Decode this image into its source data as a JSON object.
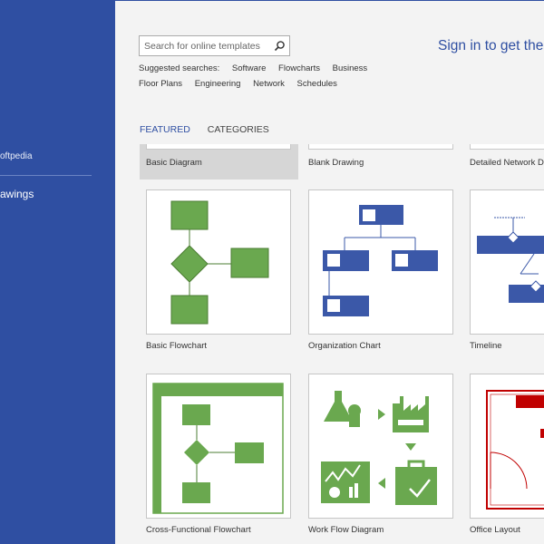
{
  "sidebar": {
    "user": "oftpedia",
    "item": "awings"
  },
  "search": {
    "placeholder": "Search for online templates"
  },
  "suggested": {
    "label": "Suggested searches:",
    "items": [
      "Software",
      "Flowcharts",
      "Business",
      "Floor Plans",
      "Engineering",
      "Network",
      "Schedules"
    ]
  },
  "signin": "Sign in to get the",
  "tabs": [
    {
      "label": "FEATURED",
      "active": true
    },
    {
      "label": "CATEGORIES",
      "active": false
    }
  ],
  "previous_row": [
    "Basic Diagram",
    "Blank Drawing",
    "Detailed Network D"
  ],
  "templates": [
    {
      "label": "Basic Flowchart",
      "icon": "basic-flowchart-thumbnail"
    },
    {
      "label": "Organization Chart",
      "icon": "organization-chart-thumbnail"
    },
    {
      "label": "Timeline",
      "icon": "timeline-thumbnail"
    },
    {
      "label": "Cross-Functional Flowchart",
      "icon": "cross-functional-flowchart-thumbnail"
    },
    {
      "label": "Work Flow Diagram",
      "icon": "work-flow-diagram-thumbnail"
    },
    {
      "label": "Office Layout",
      "icon": "office-layout-thumbnail"
    }
  ],
  "colors": {
    "sidebar": "#2f4fa2",
    "accent_blue": "#2f4fa2",
    "diagram_green": "#6aa84f",
    "diagram_blue": "#3b58a8",
    "layout_red": "#c00000"
  }
}
